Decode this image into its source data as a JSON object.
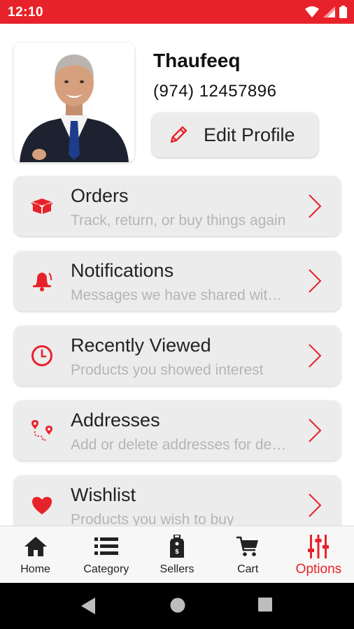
{
  "status_bar": {
    "time": "12:10"
  },
  "profile": {
    "name": "Thaufeeq",
    "phone": "(974) 12457896",
    "edit_label": "Edit Profile"
  },
  "menu": [
    {
      "title": "Orders",
      "subtitle": "Track, return, or buy things again",
      "icon": "box-icon"
    },
    {
      "title": "Notifications",
      "subtitle": "Messages we have shared with you",
      "icon": "bell-icon"
    },
    {
      "title": "Recently Viewed",
      "subtitle": "Products you showed interest",
      "icon": "clock-icon"
    },
    {
      "title": "Addresses",
      "subtitle": "Add or delete addresses for delivery",
      "icon": "route-pin-icon"
    },
    {
      "title": "Wishlist",
      "subtitle": "Products you wish to buy",
      "icon": "heart-icon"
    }
  ],
  "bottom_nav": [
    {
      "label": "Home",
      "icon": "home-icon"
    },
    {
      "label": "Category",
      "icon": "list-icon"
    },
    {
      "label": "Sellers",
      "icon": "tag-icon"
    },
    {
      "label": "Cart",
      "icon": "cart-icon"
    },
    {
      "label": "Options",
      "icon": "sliders-icon",
      "active": true
    }
  ],
  "colors": {
    "accent": "#e8222a",
    "card": "#ececec",
    "subtext": "#b5b5b5"
  }
}
